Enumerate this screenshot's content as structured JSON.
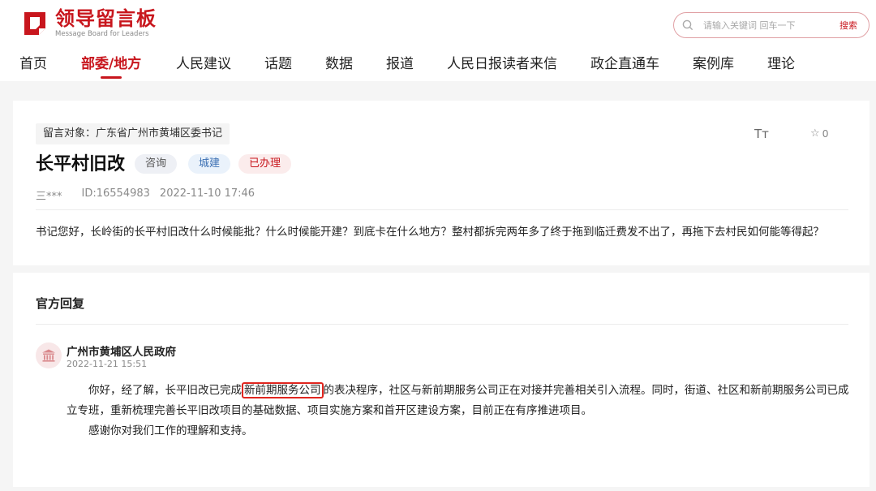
{
  "brand": {
    "name_cn": "领导留言板",
    "name_en": "Message Board for Leaders",
    "color": "#c8161d"
  },
  "search": {
    "placeholder": "请输入关键词 回车一下",
    "button_label": "搜索"
  },
  "nav": {
    "items": [
      {
        "label": "首页"
      },
      {
        "label": "部委/地方",
        "active": true
      },
      {
        "label": "人民建议"
      },
      {
        "label": "话题"
      },
      {
        "label": "数据"
      },
      {
        "label": "报道"
      },
      {
        "label": "人民日报读者来信"
      },
      {
        "label": "政企直通车"
      },
      {
        "label": "案例库"
      },
      {
        "label": "理论"
      }
    ]
  },
  "message": {
    "target": "留言对象：广东省广州市黄埔区委书记",
    "title": "长平村旧改",
    "tags": [
      "咨询",
      "城建",
      "已办理"
    ],
    "author": "三***",
    "id": "ID:16554983",
    "datetime": "2022-11-10 17:46",
    "font_icon": "Tт",
    "favorite_count": "0",
    "content": "书记您好，长岭街的长平村旧改什么时候能批？什么时候能开建？到底卡在什么地方？整村都拆完两年多了终于拖到临迁费发不出了，再拖下去村民如何能等得起？"
  },
  "reply": {
    "heading": "官方回复",
    "organization": "广州市黄埔区人民政府",
    "datetime": "2022-11-21 15:51",
    "para1_before": "你好，经了解，长平旧改已完成",
    "para1_highlight": "新前期服务公司",
    "para1_after": "的表决程序，社区与新前期服务公司正在对接并完善相关引入流程。同时，街道、社区和新前期服务公司已成立专班，重新梳理完善长平旧改项目的基础数据、项目实施方案和首开区建设方案，目前正在有序推进项目。",
    "para2": "感谢你对我们工作的理解和支持。"
  }
}
